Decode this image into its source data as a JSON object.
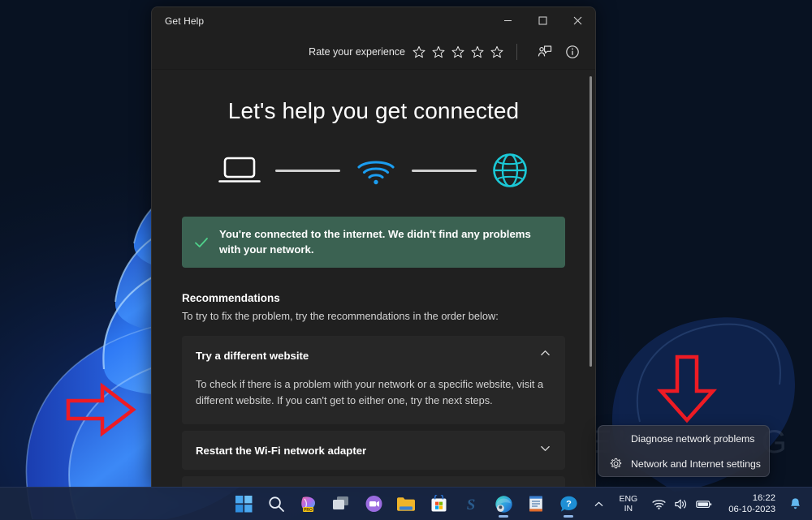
{
  "window": {
    "title": "Get Help",
    "controls": {
      "minimize": "minimize-button",
      "maximize": "maximize-button",
      "close": "close-button"
    },
    "toolbar": {
      "rate_label": "Rate your experience",
      "star_count": 5,
      "stars_filled": 0,
      "feedback_icon": "feedback-person-icon",
      "info_icon": "info-circle-icon"
    }
  },
  "main": {
    "headline": "Let's help you get connected",
    "diagram": {
      "nodes": [
        "laptop-icon",
        "wifi-icon",
        "globe-icon"
      ],
      "colors": {
        "laptop": "#ffffff",
        "wifi": "#1b9df0",
        "globe": "#1bc8d6",
        "line": "#cfcfcf"
      }
    },
    "status": {
      "icon": "check-icon",
      "text": "You're connected to the internet. We didn't find any problems with your network.",
      "background": "#3b6252",
      "check_color": "#4fd18b"
    },
    "recommendations_heading": "Recommendations",
    "recommendations_sub": "To try to fix the problem, try the recommendations in the order below:",
    "cards": [
      {
        "title": "Try a different website",
        "expanded": true,
        "chevron": "chevron-up-icon",
        "body": "To check if there is a problem with your network or a specific website, visit a different website. If you can't get to either one, try the next steps."
      },
      {
        "title": "Restart the Wi-Fi network adapter",
        "expanded": false,
        "chevron": "chevron-down-icon",
        "body": ""
      }
    ]
  },
  "context_menu": {
    "items": [
      {
        "label": "Diagnose network problems",
        "icon": null
      },
      {
        "label": "Network and Internet settings",
        "icon": "gear-icon"
      }
    ]
  },
  "watermark": "GEEKERMAG",
  "annotations": {
    "arrow_right": "red-arrow-right",
    "arrow_down": "red-arrow-down",
    "color": "#ee1b24"
  },
  "taskbar": {
    "apps": [
      {
        "name": "start-button",
        "label": "Start",
        "active": false
      },
      {
        "name": "search-button",
        "label": "Search",
        "active": false
      },
      {
        "name": "copilot-pro-button",
        "label": "Copilot Pro",
        "active": false
      },
      {
        "name": "task-view-button",
        "label": "Task View",
        "active": false
      },
      {
        "name": "teams-chat-button",
        "label": "Chat",
        "active": false
      },
      {
        "name": "file-explorer-button",
        "label": "File Explorer",
        "active": false
      },
      {
        "name": "microsoft-store-button",
        "label": "Microsoft Store",
        "active": false
      },
      {
        "name": "skype-button",
        "label": "Skype",
        "active": false
      },
      {
        "name": "microsoft-edge-button",
        "label": "Microsoft Edge",
        "active": true
      },
      {
        "name": "notepad-button",
        "label": "Notepad",
        "active": false
      },
      {
        "name": "get-help-button",
        "label": "Get Help",
        "active": true
      }
    ],
    "tray": {
      "chevron": "show-hidden-icons-chevron",
      "language_line1": "ENG",
      "language_line2": "IN",
      "wifi_icon": "wifi-tray-icon",
      "volume_icon": "volume-tray-icon",
      "battery_icon": "battery-tray-icon",
      "time": "16:22",
      "date": "06-10-2023",
      "notification_icon": "notification-bell-icon"
    }
  }
}
